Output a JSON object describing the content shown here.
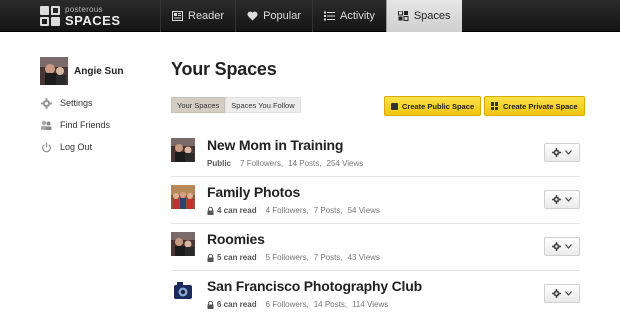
{
  "brand": {
    "small": "posterous",
    "big": "SPACES"
  },
  "nav": [
    {
      "label": "Reader",
      "icon": "reader-icon",
      "active": false
    },
    {
      "label": "Popular",
      "icon": "heart-icon",
      "active": false
    },
    {
      "label": "Activity",
      "icon": "list-icon",
      "active": false
    },
    {
      "label": "Spaces",
      "icon": "grid-icon",
      "active": true
    }
  ],
  "user": {
    "name": "Angie Sun"
  },
  "sidebar": [
    {
      "label": "Settings",
      "icon": "gear-icon"
    },
    {
      "label": "Find Friends",
      "icon": "friends-icon"
    },
    {
      "label": "Log Out",
      "icon": "power-icon"
    }
  ],
  "main": {
    "title": "Your Spaces",
    "tabs": [
      {
        "label": "Your Spaces",
        "active": true
      },
      {
        "label": "Spaces You Follow",
        "active": false
      }
    ],
    "create_public": "Create Public Space",
    "create_private": "Create Private Space"
  },
  "spaces": [
    {
      "name": "New Mom in Training",
      "privacy": "Public",
      "locked": false,
      "followers": "7 Followers,",
      "posts": "14 Posts,",
      "views": "254 Views"
    },
    {
      "name": "Family Photos",
      "privacy": "4 can read",
      "locked": true,
      "followers": "4 Followers,",
      "posts": "7 Posts,",
      "views": "54 Views"
    },
    {
      "name": "Roomies",
      "privacy": "5 can read",
      "locked": true,
      "followers": "5 Followers,",
      "posts": "7 Posts,",
      "views": "43 Views"
    },
    {
      "name": "San Francisco Photography Club",
      "privacy": "6 can read",
      "locked": true,
      "followers": "6 Followers,",
      "posts": "14 Posts,",
      "views": "114 Views"
    }
  ],
  "colors": {
    "topbar": "#1e1e1e",
    "accent_yellow": "#f5d01e",
    "active_tab": "#d3cdc4"
  }
}
